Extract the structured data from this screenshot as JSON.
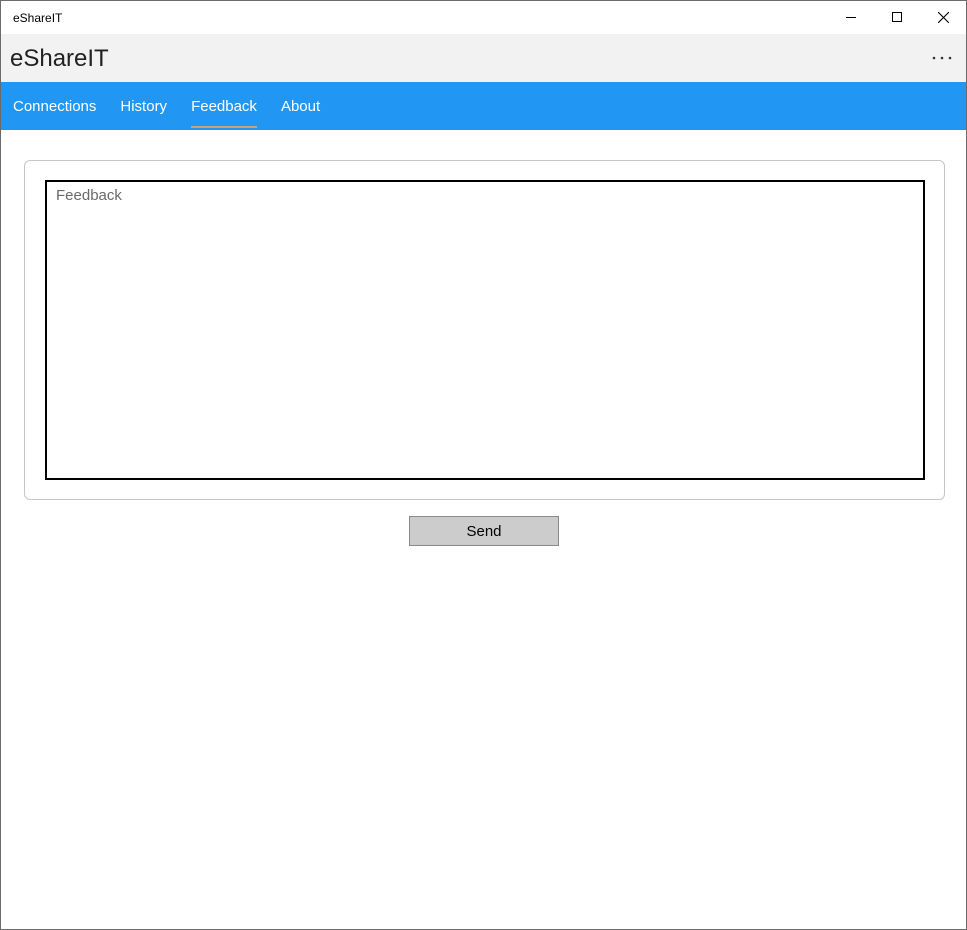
{
  "window": {
    "title": "eShareIT",
    "minimize_icon": "minimize-icon",
    "maximize_icon": "maximize-icon",
    "close_icon": "close-icon"
  },
  "header": {
    "app_title": "eShareIT",
    "more_icon": "more-icon"
  },
  "nav": {
    "tabs": [
      {
        "label": "Connections",
        "active": false
      },
      {
        "label": "History",
        "active": false
      },
      {
        "label": "Feedback",
        "active": true
      },
      {
        "label": "About",
        "active": false
      }
    ],
    "background": "#2196f3",
    "active_underline": "#c8a37a"
  },
  "feedback": {
    "placeholder": "Feedback",
    "value": ""
  },
  "actions": {
    "send_label": "Send"
  }
}
